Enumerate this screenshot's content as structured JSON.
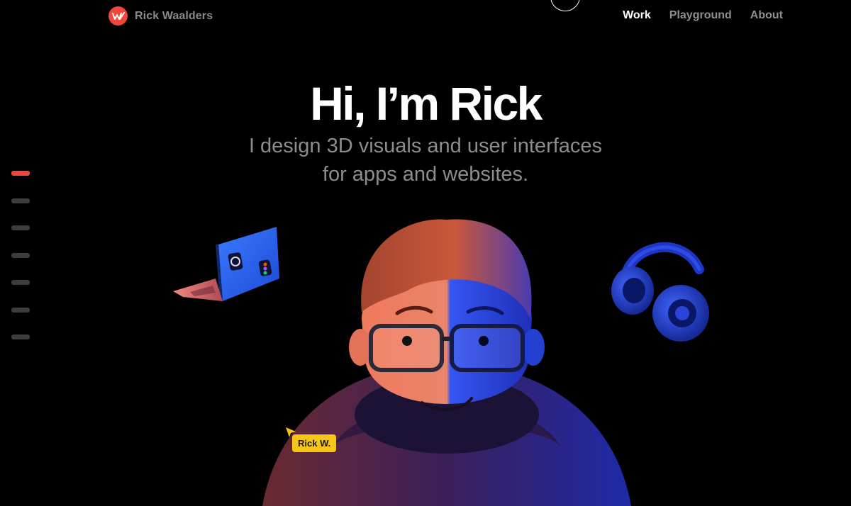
{
  "header": {
    "brand_name": "Rick Waalders",
    "nav": [
      {
        "label": "Work",
        "active": true
      },
      {
        "label": "Playground",
        "active": false
      },
      {
        "label": "About",
        "active": false
      }
    ]
  },
  "hero": {
    "title": "Hi, I’m Rick",
    "subtitle_line1": "I design 3D visuals and user interfaces",
    "subtitle_line2": "for apps and websites."
  },
  "side_nav": {
    "count": 7,
    "active_index": 0
  },
  "cursor_tag": "Rick W.",
  "colors": {
    "accent": "#f0473a",
    "background": "#000000",
    "nav_inactive": "#8e8e8e",
    "tag": "#f5c518"
  },
  "icons": [
    "rw-logo-icon",
    "laptop-illustration",
    "headphones-illustration",
    "avatar-illustration",
    "cursor-arrow-icon"
  ]
}
